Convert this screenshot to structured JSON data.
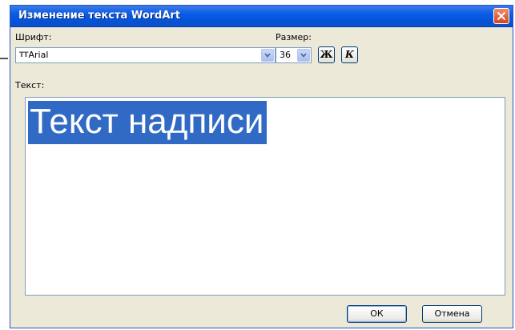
{
  "window": {
    "title": "Изменение текста WordArt"
  },
  "font": {
    "label": "Шрифт:",
    "value": "Arial"
  },
  "size": {
    "label": "Размер:",
    "value": "36"
  },
  "format": {
    "bold_label": "Ж",
    "italic_label": "К"
  },
  "text": {
    "label": "Текст:",
    "value": "Текст надписи"
  },
  "buttons": {
    "ok": "ОК",
    "cancel": "Отмена"
  },
  "colors": {
    "titlebar": "#0a5ce6",
    "dialog_bg": "#ece9d8",
    "selection": "#316ac5"
  },
  "icons": {
    "font_type": "truetype-icon",
    "close": "close-icon",
    "dropdown": "chevron-down-icon"
  }
}
